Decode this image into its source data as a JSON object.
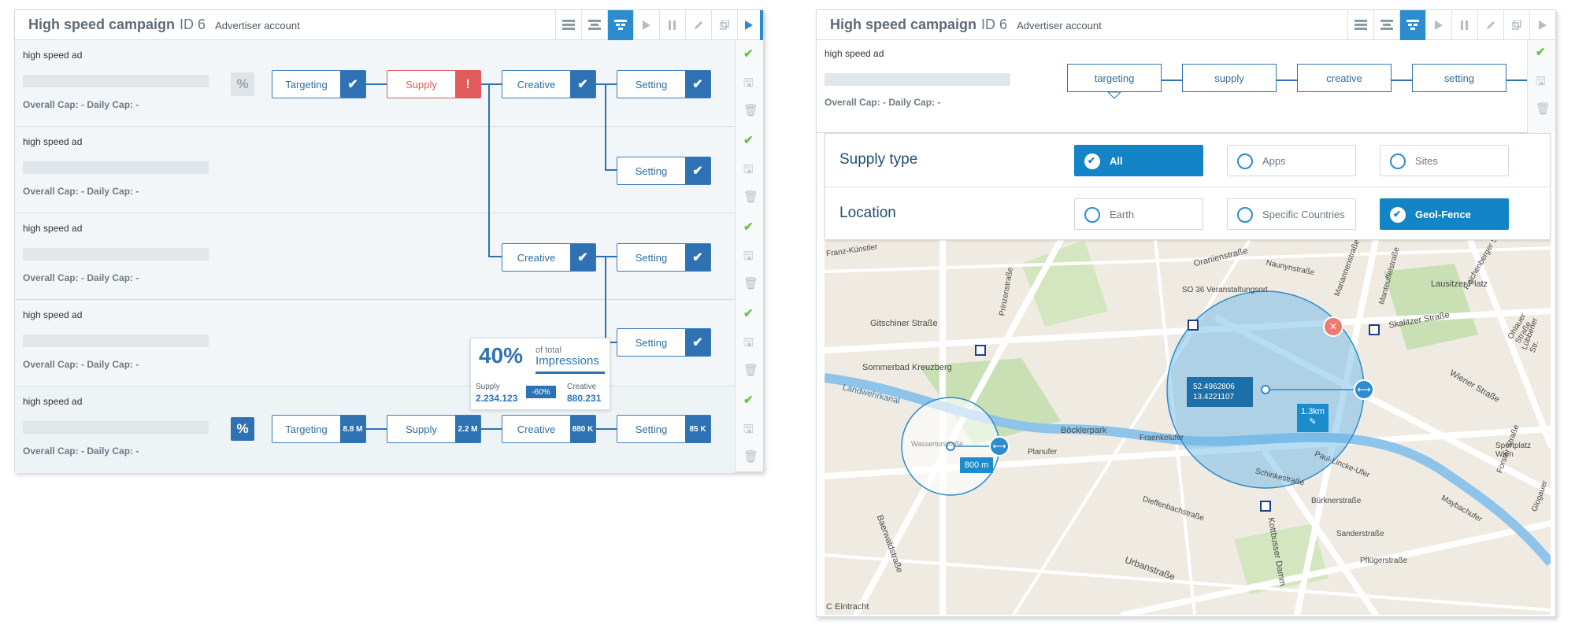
{
  "left": {
    "header": {
      "title": "High speed campaign",
      "id": "ID 6",
      "account": "Advertiser account"
    },
    "rows": [
      {
        "name": "high speed ad",
        "caps": "Overall Cap: -   Daily Cap: -"
      },
      {
        "name": "high speed ad",
        "caps": "Overall Cap: -   Daily Cap: -"
      },
      {
        "name": "high speed ad",
        "caps": "Overall Cap: -   Daily Cap: -"
      },
      {
        "name": "high speed ad",
        "caps": "Overall Cap: -   Daily Cap: -"
      },
      {
        "name": "high speed ad",
        "caps": "Overall Cap: -   Daily Cap: -"
      }
    ],
    "pct_symbol": "%",
    "nodes": {
      "targeting": "Targeting",
      "supply": "Supply",
      "creative": "Creative",
      "setting": "Setting",
      "warn_mark": "!",
      "check": "✔"
    },
    "counts": {
      "targeting": "8.8 M",
      "supply": "2.2 M",
      "creative": "880 K",
      "setting": "85 K"
    },
    "tooltip": {
      "percent": "40%",
      "of_total": "of total",
      "metric": "Impressions",
      "supply_label": "Supply",
      "supply_value": "2.234.123",
      "change": "-60%",
      "creative_label": "Creative",
      "creative_value": "880.231"
    }
  },
  "right": {
    "header": {
      "title": "High speed campaign",
      "id": "ID 6",
      "account": "Advertiser account"
    },
    "ad": {
      "name": "high speed ad",
      "caps": "Overall Cap: -   Daily Cap: -"
    },
    "steps": [
      "targeting",
      "supply",
      "creative",
      "setting"
    ],
    "supply_type": {
      "label": "Supply type",
      "options": [
        "All",
        "Apps",
        "Sites"
      ],
      "selected": "All"
    },
    "location": {
      "label": "Location",
      "options": [
        "Earth",
        "Specific Countries",
        "Geol-Fence"
      ],
      "selected": "Geol-Fence"
    },
    "map": {
      "coords_lat": "52.4962806",
      "coords_lon": "13.4221107",
      "radius_large": "1.3km",
      "radius_small": "800 m",
      "labels": [
        "Gitschiner Straße",
        "Skalitzer Straße",
        "Oranienstraße",
        "Lausitzer Platz",
        "Sommerbad Kreuzberg",
        "Böcklerpark",
        "Landwehrkanal",
        "Fraenkelufer",
        "Paul-Lincke-Ufer",
        "Wiener Straße",
        "Sportplatz Wien",
        "Urbanstraße",
        "Kottbusser Damm",
        "Baerwaldstraße",
        "Dieffenbachstraße",
        "Sanderstraße",
        "Pflügerstraße",
        "Maybachufer",
        "Reichenberger Straße",
        "SO 36 Veranstaltungsort",
        "Prinzenstraße",
        "Wassertorstraße",
        "Naunynstraße",
        "Mariannenstraße",
        "Schinkestraße",
        "Bürknerstraße",
        "Planufer",
        "Glogauer",
        "Manteuffelstraße",
        "Forster Straße",
        "Ohlauer Straße",
        "C Eintracht",
        "Franz-Künstler",
        "Lübbener Str."
      ]
    },
    "accent": "#2b8ccf",
    "warn": "#e05b5b",
    "ok": "#6cc04a"
  }
}
